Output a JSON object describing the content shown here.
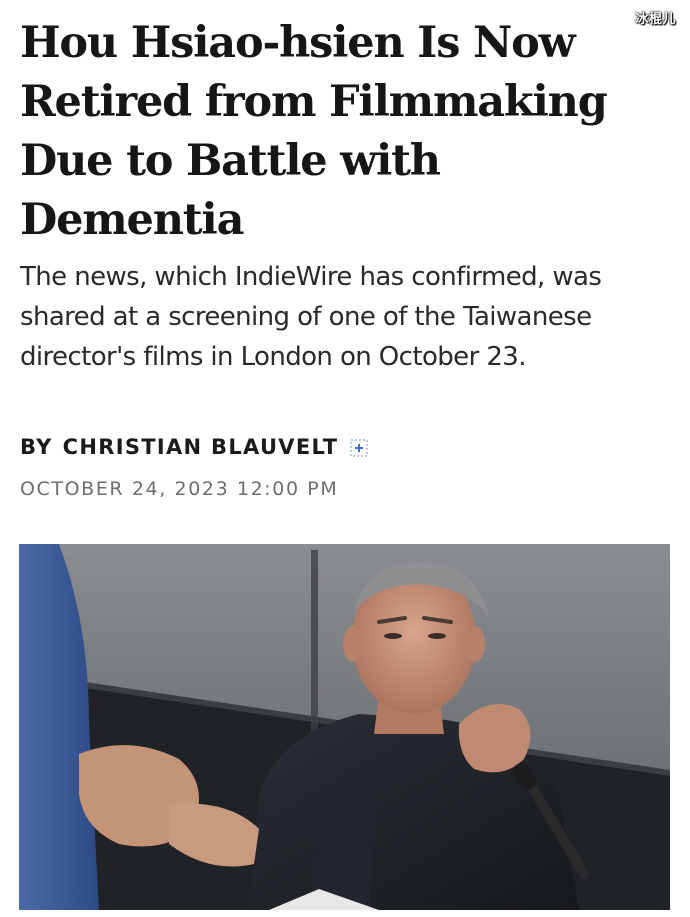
{
  "watermark": "冰棍儿",
  "article": {
    "headline": "Hou Hsiao-hsien Is Now Retired from Filmmaking Due to Battle with Dementia",
    "dek": "The news, which IndieWire has confirmed, was shared at a screening of one of the Taiwanese director's films in London on October 23.",
    "byline_prefix": "BY",
    "author": "CHRISTIAN BLAUVELT",
    "date": "OCTOBER 24, 2023 12:00 PM",
    "follow_icon": "add-author-icon"
  },
  "photo": {
    "subject": "photo"
  },
  "colors": {
    "headline": "#161616",
    "dek": "#2a2a2a",
    "date": "#6e6e6e",
    "follow_icon": "#3a6fd8"
  }
}
